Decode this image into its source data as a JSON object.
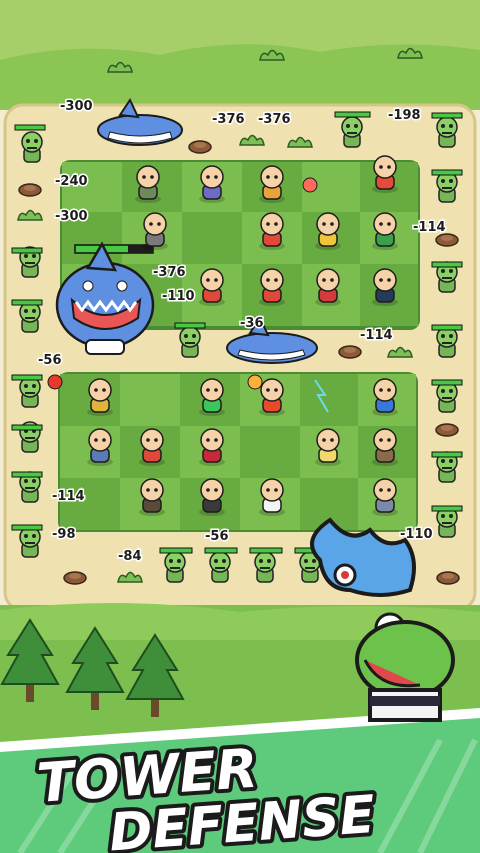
{
  "title": {
    "line1": "TOWER",
    "line2": "DEFENSE"
  },
  "damage_numbers": [
    "-300",
    "-376",
    "-376",
    "-198",
    "-240",
    "-300",
    "-114",
    "-376",
    "-110",
    "-36",
    "-114",
    "-56",
    "-114",
    "-98",
    "-84",
    "-56",
    "-110"
  ],
  "colors": {
    "path": "#f3e6b8",
    "grass_light": "#7cc45a",
    "grass_dark": "#5aa540",
    "tile_light": "#78b84d",
    "tile_dark": "#63a63f",
    "zombie": "#8bd064",
    "shark": "#5e8fe0",
    "banner_green": "#5ecb7c",
    "hp_bar": "#49c843"
  },
  "icons": [
    "zombie-enemy",
    "shark-boss",
    "hero-unit",
    "mushroom-zombie-mascot",
    "pine-tree"
  ]
}
